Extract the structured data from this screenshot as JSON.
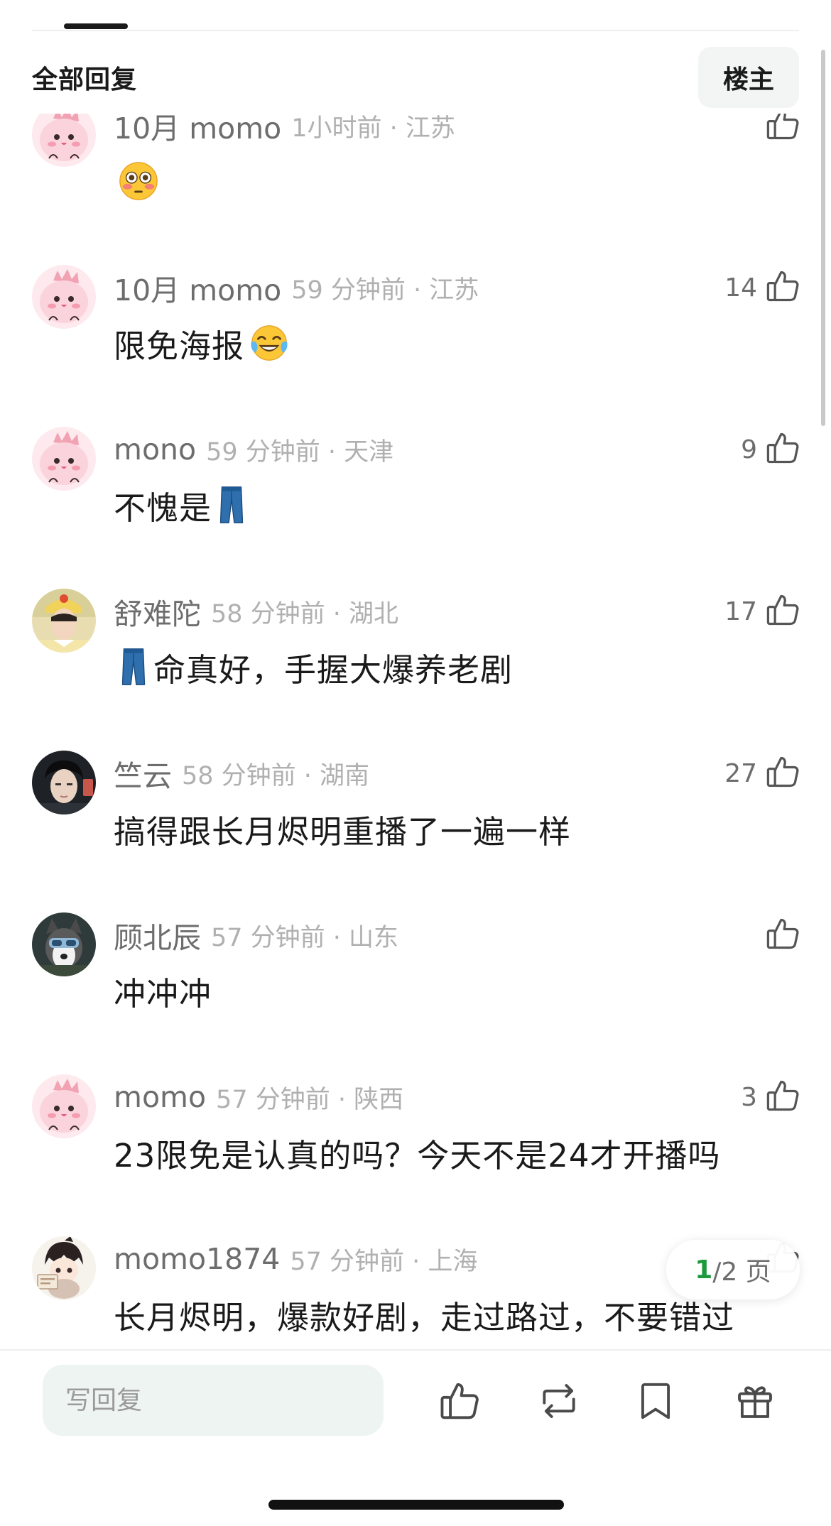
{
  "header": {
    "title": "全部回复",
    "owner_button": "楼主"
  },
  "comments": [
    {
      "avatar": "pink-dino-avatar",
      "name": "10月 momo",
      "meta": "1小时前 · 江苏",
      "likes": "",
      "text": "",
      "emoji": "flushed-face-emoji"
    },
    {
      "avatar": "pink-dino-avatar",
      "name": "10月 momo",
      "meta": "59 分钟前 · 江苏",
      "likes": "14",
      "text": "限免海报",
      "emoji": "tears-of-joy-emoji"
    },
    {
      "avatar": "pink-dino-avatar",
      "name": "mono",
      "meta": "59 分钟前 · 天津",
      "likes": "9",
      "text": "不愧是",
      "emoji": "jeans-emoji"
    },
    {
      "avatar": "costume-actor-avatar",
      "name": "舒难陀",
      "meta": "58 分钟前 · 湖北",
      "likes": "17",
      "text": "命真好，手握大爆养老剧",
      "emoji": "jeans-emoji"
    },
    {
      "avatar": "dark-portrait-avatar",
      "name": "竺云",
      "meta": "58 分钟前 · 湖南",
      "likes": "27",
      "text": "搞得跟长月烬明重播了一遍一样",
      "emoji": ""
    },
    {
      "avatar": "husky-avatar",
      "name": "顾北辰",
      "meta": "57 分钟前 · 山东",
      "likes": "",
      "text": "冲冲冲",
      "emoji": ""
    },
    {
      "avatar": "pink-dino-avatar",
      "name": "momo",
      "meta": "57 分钟前 · 陕西",
      "likes": "3",
      "text": "23限免是认真的吗？今天不是24才开播吗",
      "emoji": ""
    },
    {
      "avatar": "chibi-avatar",
      "name": "momo1874",
      "meta": "57 分钟前 · 上海",
      "likes": "",
      "text": "长月烬明，爆款好剧，走过路过，不要错过",
      "emoji": ""
    }
  ],
  "pagination": {
    "current": "1",
    "total_text": "/2 页"
  },
  "bottom_bar": {
    "reply_placeholder": "写回复",
    "icons": [
      "thumbs-up-icon",
      "repost-icon",
      "bookmark-icon",
      "gift-icon"
    ]
  }
}
